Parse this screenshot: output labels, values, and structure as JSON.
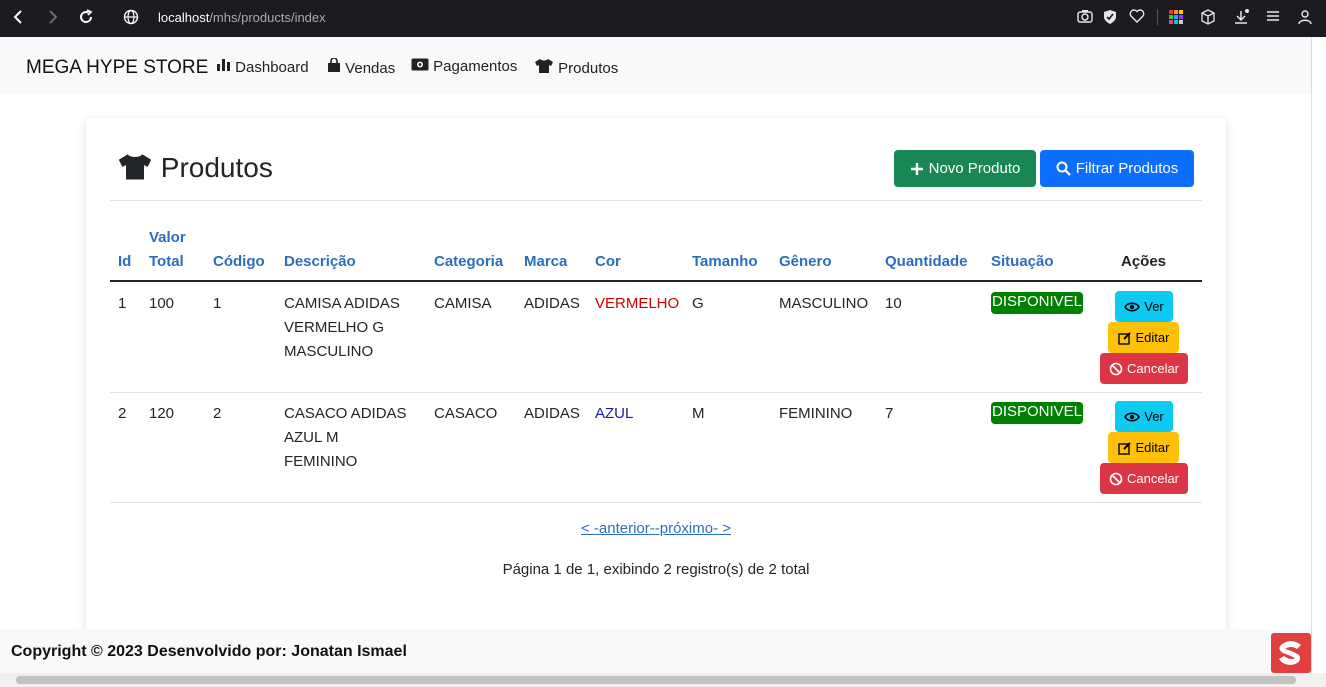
{
  "browser": {
    "url_host": "localhost",
    "url_path": "/mhs/products/index"
  },
  "navbar": {
    "brand": "MEGA HYPE STORE",
    "items": [
      {
        "label": "Dashboard",
        "icon": "bar-chart-icon"
      },
      {
        "label": "Vendas",
        "icon": "shopping-bag-icon"
      },
      {
        "label": "Pagamentos",
        "icon": "money-icon"
      },
      {
        "label": "Produtos",
        "icon": "shirt-icon"
      }
    ]
  },
  "page": {
    "title": "Produtos",
    "new_button": "Novo Produto",
    "filter_button": "Filtrar Produtos"
  },
  "table": {
    "headers": {
      "id": "Id",
      "valor1": "Valor",
      "valor2": "Total",
      "codigo": "Código",
      "descricao": "Descrição",
      "categoria": "Categoria",
      "marca": "Marca",
      "cor": "Cor",
      "tamanho": "Tamanho",
      "genero": "Gênero",
      "quantidade": "Quantidade",
      "situacao": "Situação",
      "acoes": "Ações"
    },
    "rows": [
      {
        "id": "1",
        "valor": "100",
        "codigo": "1",
        "desc1": "CAMISA ADIDAS",
        "desc2": "VERMELHO G",
        "desc3": "MASCULINO",
        "categoria": "CAMISA",
        "marca": "ADIDAS",
        "cor": "VERMELHO",
        "cor_color": "#cc0000",
        "tamanho": "G",
        "genero": "MASCULINO",
        "quantidade": "10",
        "situacao": "DISPONIVEL"
      },
      {
        "id": "2",
        "valor": "120",
        "codigo": "2",
        "desc1": "CASACO ADIDAS",
        "desc2": "AZUL M",
        "desc3": "FEMININO",
        "categoria": "CASACO",
        "marca": "ADIDAS",
        "cor": "AZUL",
        "cor_color": "#1a1aa6",
        "tamanho": "M",
        "genero": "FEMININO",
        "quantidade": "7",
        "situacao": "DISPONIVEL"
      }
    ],
    "actions": {
      "view": "Ver",
      "edit": "Editar",
      "cancel": "Cancelar"
    }
  },
  "pagination": {
    "links": "< -anterior--próximo- >",
    "info": "Página 1 de 1, exibindo 2 registro(s) de 2 total"
  },
  "footer": {
    "text": "Copyright © 2023 Desenvolvido por: Jonatan Ismael"
  },
  "colors": {
    "primary": "#0d6efd",
    "success": "#198754",
    "info": "#0dcaf0",
    "warning": "#ffc107",
    "danger": "#dc3545",
    "link_header": "#2a6fbf"
  }
}
